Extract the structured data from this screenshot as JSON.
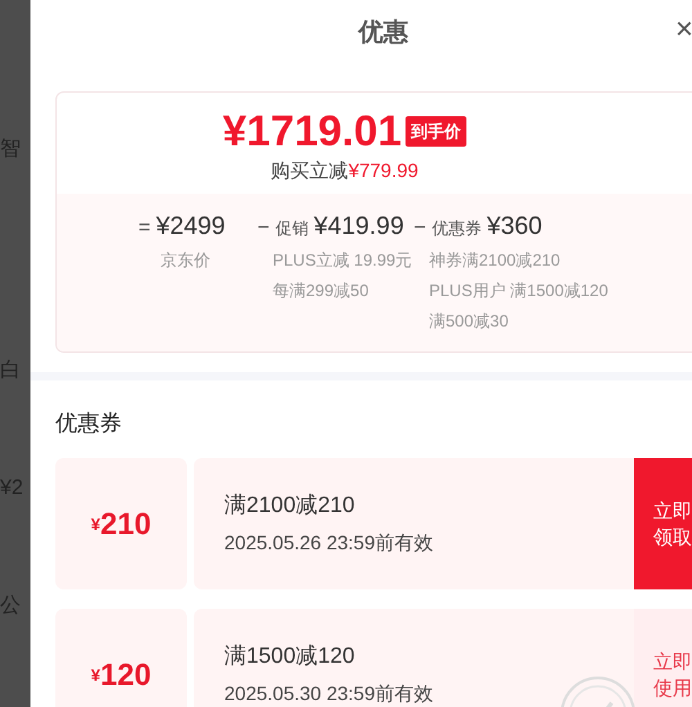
{
  "background_fragments": [
    "智",
    "白",
    "¥2",
    "公"
  ],
  "sheet": {
    "title": "优惠",
    "close": "×"
  },
  "summary": {
    "final_price": "¥1719.01",
    "final_badge": "到手价",
    "saving_label": "购买立减",
    "saving_amount": "¥779.99",
    "breakdown": [
      {
        "operator": "=",
        "amount": "¥2499",
        "notes": [
          "京东价"
        ]
      },
      {
        "operator": "−",
        "label": "促销",
        "amount": "¥419.99",
        "notes": [
          "PLUS立减 19.99元",
          "每满299减50"
        ]
      },
      {
        "operator": "−",
        "label": "优惠券",
        "amount": "¥360",
        "notes": [
          "神券满2100减210",
          "PLUS用户 满1500减120",
          "满500减30"
        ]
      }
    ]
  },
  "coupons_heading": "优惠券",
  "coupons": [
    {
      "currency": "¥",
      "value": "210",
      "condition": "满2100减210",
      "validity": "2025.05.26 23:59前有效",
      "button_lines": [
        "立即",
        "领取"
      ],
      "claimed": false
    },
    {
      "currency": "¥",
      "value": "120",
      "condition": "满1500减120",
      "validity": "2025.05.30 23:59前有效",
      "button_lines": [
        "立即",
        "使用"
      ],
      "claimed": true
    }
  ]
}
